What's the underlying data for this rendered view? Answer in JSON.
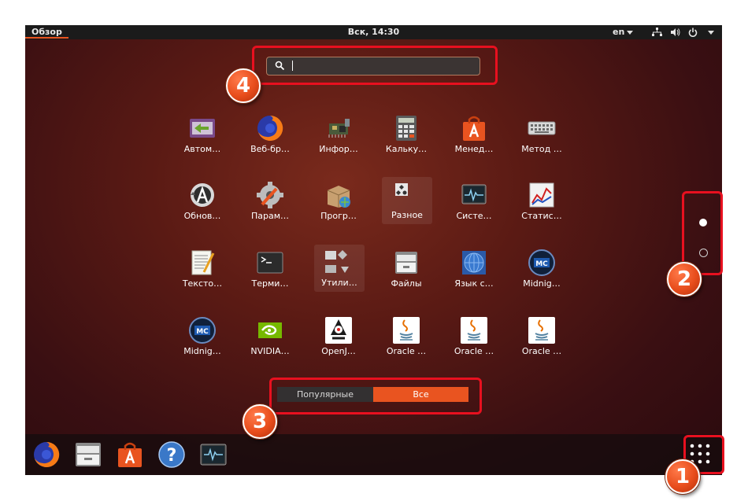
{
  "topbar": {
    "activities": "Обзор",
    "clock": "Вск, 14:30",
    "language": "en"
  },
  "search": {
    "value": "",
    "placeholder": ""
  },
  "apps": [
    {
      "label": "Автом…",
      "icon": "text-replace-icon"
    },
    {
      "label": "Веб-бр…",
      "icon": "firefox-icon"
    },
    {
      "label": "Инфор…",
      "icon": "hardware-info-icon"
    },
    {
      "label": "Кальку…",
      "icon": "calculator-icon"
    },
    {
      "label": "Менед…",
      "icon": "software-center-icon"
    },
    {
      "label": "Метод …",
      "icon": "keyboard-icon"
    },
    {
      "label": "Обнов…",
      "icon": "software-updater-icon"
    },
    {
      "label": "Парам…",
      "icon": "settings-icon"
    },
    {
      "label": "Прогр…",
      "icon": "software-sources-icon"
    },
    {
      "label": "Разное",
      "icon": "misc-folder-icon"
    },
    {
      "label": "Систе…",
      "icon": "system-monitor-icon"
    },
    {
      "label": "Статис…",
      "icon": "power-statistics-icon"
    },
    {
      "label": "Тексто…",
      "icon": "text-editor-icon"
    },
    {
      "label": "Терми…",
      "icon": "terminal-icon"
    },
    {
      "label": "Утили…",
      "icon": "utilities-folder-icon"
    },
    {
      "label": "Файлы",
      "icon": "files-icon"
    },
    {
      "label": "Язык с…",
      "icon": "language-support-icon"
    },
    {
      "label": "Midnig…",
      "icon": "midnight-commander-icon"
    },
    {
      "label": "Midnig…",
      "icon": "midnight-commander-icon"
    },
    {
      "label": "NVIDIA…",
      "icon": "nvidia-icon"
    },
    {
      "label": "OpenJ…",
      "icon": "java-icon"
    },
    {
      "label": "Oracle …",
      "icon": "java-icon"
    },
    {
      "label": "Oracle …",
      "icon": "java-icon"
    },
    {
      "label": "Oracle …",
      "icon": "java-icon"
    }
  ],
  "switcher": {
    "popular": "Популярные",
    "all": "Все"
  },
  "badges": {
    "one": "1",
    "two": "2",
    "three": "3",
    "four": "4"
  },
  "colors": {
    "accent": "#e95420",
    "highlight": "#e8101f",
    "panel": "#1b1b1b"
  }
}
